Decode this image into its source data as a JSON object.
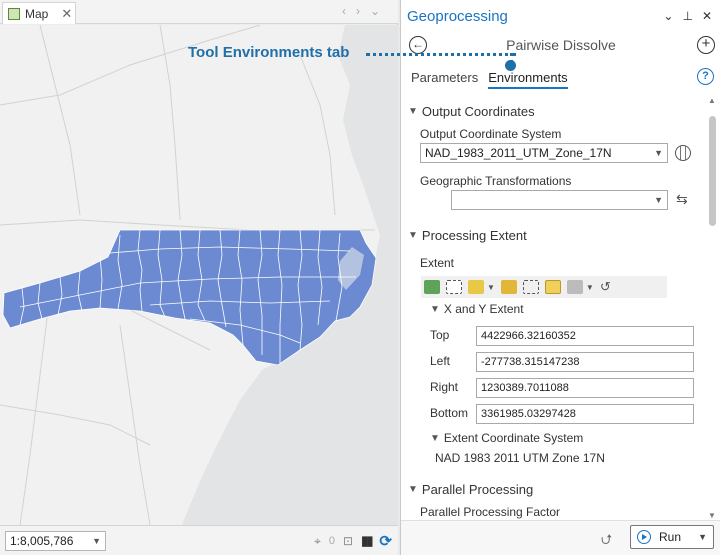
{
  "map": {
    "tab_label": "Map",
    "scale": "1:8,005,786",
    "status_count": "0",
    "colors": {
      "counties": "#6b8ad1",
      "land": "#f1f1f1",
      "water": "#e2e3e4"
    }
  },
  "geoprocessing": {
    "title": "Geoprocessing",
    "tool_name": "Pairwise Dissolve",
    "tabs": [
      {
        "label": "Parameters",
        "active": false
      },
      {
        "label": "Environments",
        "active": true
      }
    ],
    "sections": {
      "output_coordinates": {
        "title": "Output Coordinates",
        "coord_system_label": "Output Coordinate System",
        "coord_system_value": "NAD_1983_2011_UTM_Zone_17N",
        "geo_transform_label": "Geographic Transformations",
        "geo_transform_value": ""
      },
      "processing_extent": {
        "title": "Processing Extent",
        "extent_label": "Extent",
        "xy_extent_label": "X and Y Extent",
        "fields": [
          {
            "label": "Top",
            "value": "4422966.32160352"
          },
          {
            "label": "Left",
            "value": "-277738.315147238"
          },
          {
            "label": "Right",
            "value": "1230389.7011088"
          },
          {
            "label": "Bottom",
            "value": "3361985.03297428"
          }
        ],
        "extent_cs_label": "Extent Coordinate System",
        "extent_cs_value": "NAD 1983 2011 UTM Zone 17N"
      },
      "parallel_processing": {
        "title": "Parallel Processing",
        "factor_label": "Parallel Processing Factor"
      }
    },
    "run_label": "Run",
    "accent_color": "#1a74c4"
  },
  "callout": {
    "text": "Tool Environments tab",
    "color": "#1f6fa8"
  }
}
